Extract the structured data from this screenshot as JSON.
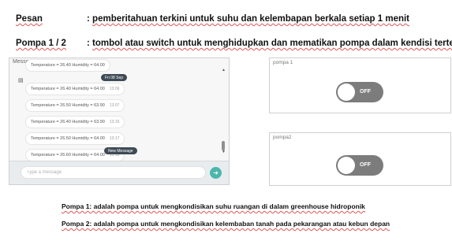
{
  "definitions": [
    {
      "term": "Pesan",
      "separator": ":",
      "description": "pemberitahuan terkini untuk suhu dan kelembapan berkala setiap 1 menit"
    },
    {
      "term": "Pompa 1 / 2",
      "separator": ":",
      "description": "tombol atau switch untuk menghidupkan dan mematikan pompa dalam kendisi tertentu"
    }
  ],
  "messenger": {
    "title": "Messenger",
    "partial_message": "Temperature = 26.40 Humidity = 64.00",
    "date_badge": "Fri 08 Sep",
    "messages": [
      {
        "text": "Temperature = 26.40 Humidity = 64.00",
        "time": "13:06"
      },
      {
        "text": "Temperature = 26.50 Humidity = 63.90",
        "time": "13:07"
      },
      {
        "text": "Temperature = 26.40 Humidity = 63.90",
        "time": "13:16"
      },
      {
        "text": "Temperature = 26.50 Humidity = 64.00",
        "time": "13:17"
      },
      {
        "text": "Temperature = 26.60 Humidity = 64.00",
        "time": "13:18"
      }
    ],
    "new_message_badge": "New Message",
    "input_placeholder": "Type a message"
  },
  "pumps": [
    {
      "title": "pompa 1",
      "state": "OFF"
    },
    {
      "title": "pompa2",
      "state": "OFF"
    }
  ],
  "notes": [
    "Pompa 1: adalah pompa untuk mengkondisikan suhu ruangan di dalam greenhouse hidroponik",
    "Pompa 2: adalah pompa untuk mengkondisikan kelembaban tanah pada pekarangan atau kebun depan"
  ],
  "colors": {
    "send_button": "#4db6ac",
    "toggle_off": "#7c7c7c",
    "badge": "#3e4a56"
  }
}
